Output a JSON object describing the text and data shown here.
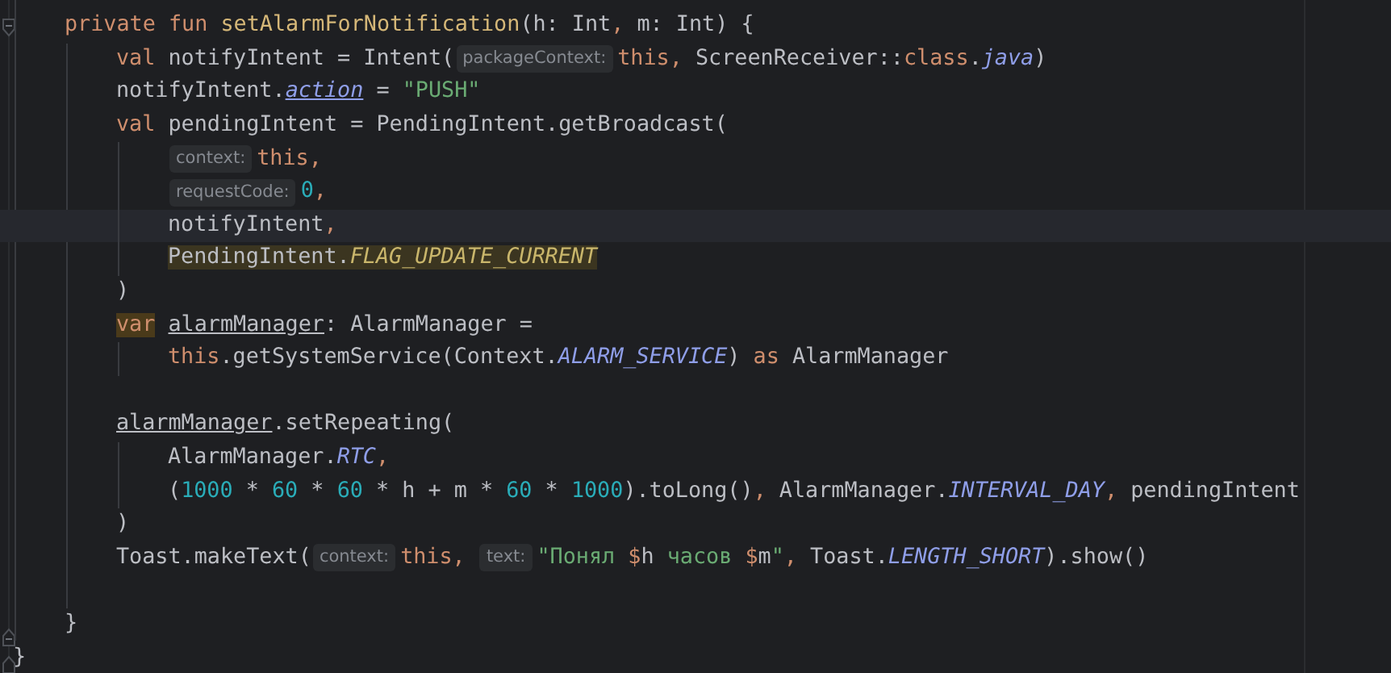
{
  "editor": {
    "lines": [
      {
        "current": false,
        "tokens": [
          {
            "kind": "keyword",
            "text": "private fun "
          },
          {
            "kind": "function",
            "text": "setAlarmForNotification"
          },
          {
            "kind": "plain",
            "text": "(h: Int"
          },
          {
            "kind": "comma",
            "text": ","
          },
          {
            "kind": "plain",
            "text": " m: Int) {"
          }
        ],
        "children": [
          {
            "current": false,
            "tokens": [
              {
                "kind": "keyword",
                "text": "val "
              },
              {
                "kind": "plain",
                "text": "notifyIntent = Intent("
              },
              {
                "kind": "hint",
                "text": "packageContext:"
              },
              {
                "kind": "keyword",
                "text": "this,"
              },
              {
                "kind": "plain",
                "text": " ScreenReceiver::"
              },
              {
                "kind": "keyword",
                "text": "class"
              },
              {
                "kind": "constant",
                "text": ".java"
              },
              {
                "kind": "plain",
                "text": ")"
              }
            ]
          },
          {
            "current": false,
            "tokens": [
              {
                "kind": "plain",
                "text": "notifyIntent."
              },
              {
                "kind": "property",
                "text": "action"
              },
              {
                "kind": "plain",
                "text": " = "
              },
              {
                "kind": "string",
                "text": "\"PUSH\""
              }
            ]
          },
          {
            "current": false,
            "tokens": [
              {
                "kind": "keyword",
                "text": "val "
              },
              {
                "kind": "plain",
                "text": "pendingIntent = PendingIntent.getBroadcast("
              }
            ],
            "children": [
              {
                "current": false,
                "tokens": [
                  {
                    "kind": "hint",
                    "text": "context:"
                  },
                  {
                    "kind": "keyword",
                    "text": "this,"
                  }
                ]
              },
              {
                "current": false,
                "tokens": [
                  {
                    "kind": "hint",
                    "text": "requestCode:"
                  },
                  {
                    "kind": "number",
                    "text": "0"
                  },
                  {
                    "kind": "comma",
                    "text": ","
                  }
                ]
              },
              {
                "current": true,
                "tokens": [
                  {
                    "kind": "plain",
                    "text": "notifyIntent"
                  },
                  {
                    "kind": "comma",
                    "text": ","
                  }
                ]
              },
              {
                "current": false,
                "tokens": [
                  {
                    "kind": "warning",
                    "text": "PendingIntent."
                  },
                  {
                    "kind": "warning_constant",
                    "text": "FLAG_UPDATE_CURRENT"
                  }
                ]
              }
            ]
          },
          {
            "current": false,
            "tokens": [
              {
                "kind": "plain",
                "text": ")"
              }
            ]
          },
          {
            "current": false,
            "tokens": [
              {
                "kind": "warning_keyword",
                "text": "var"
              },
              {
                "kind": "variable",
                "text": " alarmManager"
              },
              {
                "kind": "plain",
                "text": ": AlarmManager ="
              }
            ],
            "children": [
              {
                "current": false,
                "tokens": [
                  {
                    "kind": "keyword",
                    "text": "this"
                  },
                  {
                    "kind": "plain",
                    "text": ".getSystemService(Context."
                  },
                  {
                    "kind": "constant",
                    "text": "ALARM_SERVICE"
                  },
                  {
                    "kind": "plain",
                    "text": ") "
                  },
                  {
                    "kind": "keyword",
                    "text": "as"
                  },
                  {
                    "kind": "plain",
                    "text": " AlarmManager"
                  }
                ]
              }
            ]
          },
          {
            "current": false
          },
          {
            "current": false,
            "tokens": [
              {
                "kind": "variable",
                "text": "alarmManager"
              },
              {
                "kind": "plain",
                "text": ".setRepeating("
              }
            ],
            "children": [
              {
                "current": false,
                "tokens": [
                  {
                    "kind": "plain",
                    "text": "AlarmManager."
                  },
                  {
                    "kind": "constant",
                    "text": "RTC"
                  },
                  {
                    "kind": "comma",
                    "text": ","
                  }
                ]
              },
              {
                "current": false,
                "tokens": [
                  {
                    "kind": "plain",
                    "text": "("
                  },
                  {
                    "kind": "number",
                    "text": "1000"
                  },
                  {
                    "kind": "plain",
                    "text": " * "
                  },
                  {
                    "kind": "number",
                    "text": "60"
                  },
                  {
                    "kind": "plain",
                    "text": " * "
                  },
                  {
                    "kind": "number",
                    "text": "60"
                  },
                  {
                    "kind": "plain",
                    "text": " * h + m * "
                  },
                  {
                    "kind": "number",
                    "text": "60"
                  },
                  {
                    "kind": "plain",
                    "text": " * "
                  },
                  {
                    "kind": "number",
                    "text": "1000"
                  },
                  {
                    "kind": "plain",
                    "text": ").toLong()"
                  },
                  {
                    "kind": "comma",
                    "text": ","
                  },
                  {
                    "kind": "plain",
                    "text": " AlarmManager."
                  },
                  {
                    "kind": "constant",
                    "text": "INTERVAL_DAY"
                  },
                  {
                    "kind": "comma",
                    "text": ","
                  },
                  {
                    "kind": "plain",
                    "text": " pendingIntent"
                  }
                ]
              }
            ]
          },
          {
            "current": false,
            "tokens": [
              {
                "kind": "plain",
                "text": ")"
              }
            ]
          },
          {
            "current": false,
            "tokens": [
              {
                "kind": "plain",
                "text": "Toast.makeText("
              },
              {
                "kind": "hint",
                "text": "context:"
              },
              {
                "kind": "keyword",
                "text": "this, "
              },
              {
                "kind": "hint",
                "text": "text:"
              },
              {
                "kind": "string",
                "text": "\"Понял "
              },
              {
                "kind": "template",
                "text": "$"
              },
              {
                "kind": "plain",
                "text": "h"
              },
              {
                "kind": "string",
                "text": " часов "
              },
              {
                "kind": "template",
                "text": "$"
              },
              {
                "kind": "plain",
                "text": "m"
              },
              {
                "kind": "string",
                "text": "\""
              },
              {
                "kind": "comma",
                "text": ","
              },
              {
                "kind": "plain",
                "text": " Toast."
              },
              {
                "kind": "constant",
                "text": "LENGTH_SHORT"
              },
              {
                "kind": "plain",
                "text": ").show()"
              }
            ]
          },
          {
            "current": false
          }
        ]
      },
      {
        "current": false,
        "tokens": [
          {
            "kind": "plain",
            "text": "}"
          }
        ]
      }
    ],
    "closing": [
      {
        "current": false,
        "tokens": [
          {
            "kind": "plain",
            "text": "}"
          }
        ]
      }
    ]
  }
}
